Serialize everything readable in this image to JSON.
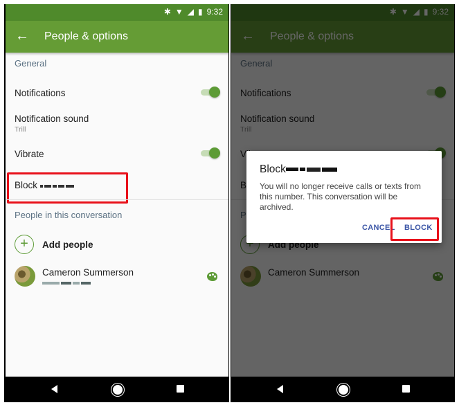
{
  "status_bar": {
    "time": "9:32",
    "icons": [
      "bluetooth-icon",
      "wifi-icon",
      "signal-icon",
      "battery-icon"
    ]
  },
  "app_bar": {
    "title": "People & options",
    "back_icon": "arrow-back-icon"
  },
  "general": {
    "section_label": "General",
    "notifications": {
      "label": "Notifications",
      "enabled": true
    },
    "notification_sound": {
      "label": "Notification sound",
      "value": "Trill"
    },
    "vibrate": {
      "label": "Vibrate",
      "enabled": true
    },
    "block": {
      "label": "Block",
      "number_redacted": true
    }
  },
  "people": {
    "section_label": "People in this conversation",
    "add_people_label": "Add people",
    "contacts": [
      {
        "name": "Cameron Summerson",
        "number_redacted": true,
        "color_icon": "palette-icon"
      }
    ]
  },
  "dialog": {
    "title": "Block",
    "body": "You will no longer receive calls or texts from this number. This conversation will be archived.",
    "cancel_label": "CANCEL",
    "block_label": "BLOCK"
  },
  "nav_bar": {
    "icons": [
      "back-icon",
      "home-icon",
      "recents-icon"
    ]
  },
  "colors": {
    "status_bar": "#4f8a2b",
    "app_bar": "#659c35",
    "accent": "#5d9b36",
    "highlight": "#e8101a",
    "dialog_button": "#3a55a6"
  }
}
